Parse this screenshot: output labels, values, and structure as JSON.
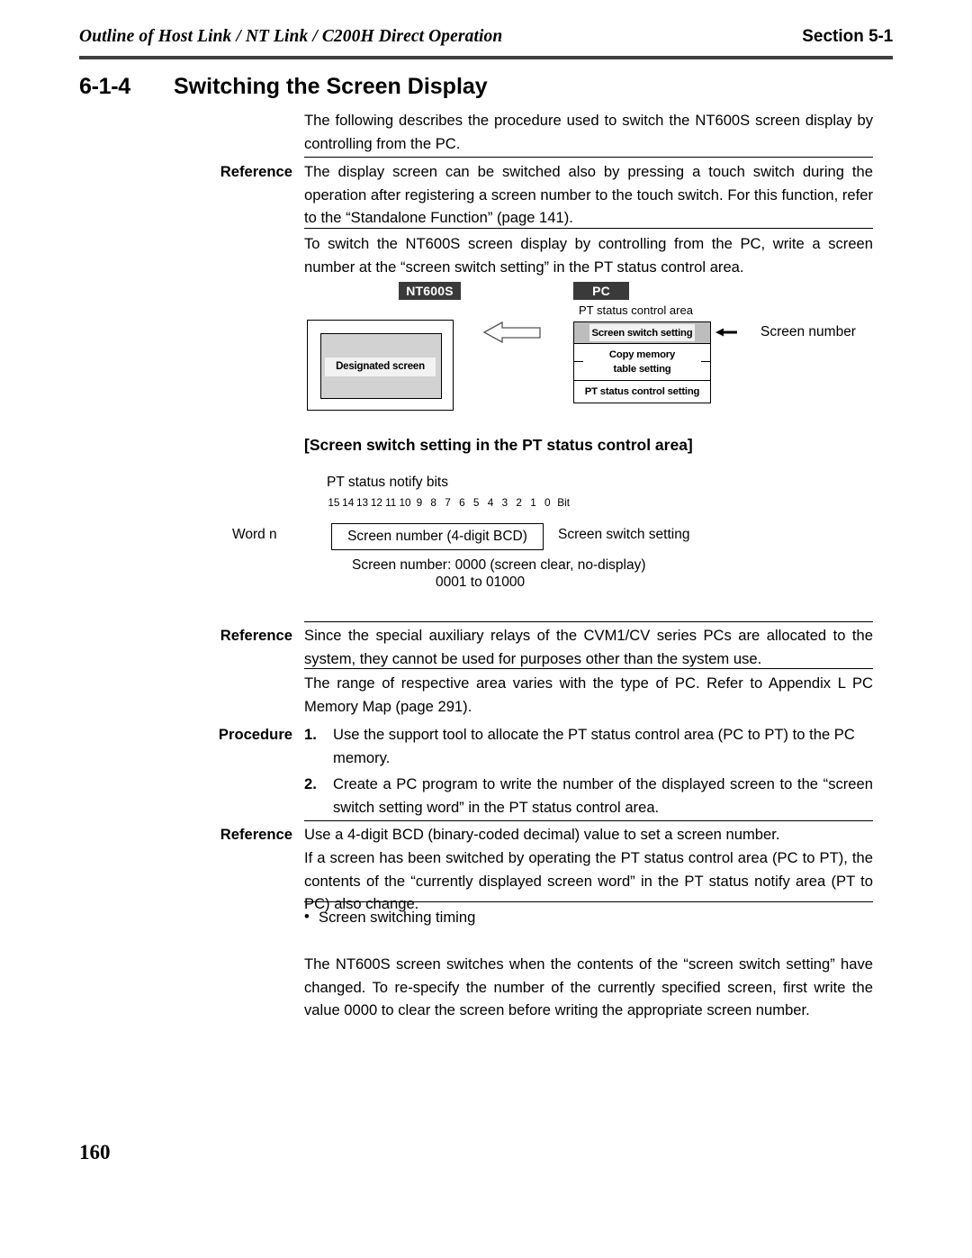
{
  "header": {
    "title": "Outline of Host Link / NT Link / C200H Direct Operation",
    "section_word": "Section",
    "section_number": "5-1"
  },
  "heading": {
    "number": "6-1-4",
    "title": "Switching the Screen Display"
  },
  "intro": {
    "text": "The following describes the procedure used to switch the NT600S screen display by controlling from the PC."
  },
  "reference1": {
    "label": "Reference",
    "text": "The display screen can be switched also by pressing a touch switch during the operation after registering a screen number to the touch switch. For this function, refer to the “Standalone Function” (page 141)."
  },
  "body1": {
    "text": "To switch the NT600S screen display by controlling from the PC, write a screen number at the “screen switch setting” in the PT status control area."
  },
  "diagram1": {
    "nt600s_tag": "NT600S",
    "pc_tag": "PC",
    "designated_screen": "Designated screen",
    "pt_status_control_area": "PT status control area",
    "rows": [
      "Screen switch setting",
      "Copy memory",
      "table setting",
      "PT status control setting"
    ],
    "screen_number_caption": "Screen number"
  },
  "diagram2": {
    "title": "[Screen switch setting in the PT status control area]",
    "notify_bits_label": "PT status notify bits",
    "bits": [
      "15",
      "14",
      "13",
      "12",
      "11",
      "10",
      "9",
      "8",
      "7",
      "6",
      "5",
      "4",
      "3",
      "2",
      "1",
      "0"
    ],
    "bit_word": "Bit",
    "word_label": "Word n",
    "box_label": "Screen number (4-digit BCD)",
    "right_label": "Screen switch setting",
    "note_line1": "Screen number: 0000 (screen clear, no-display)",
    "note_line2": "0001 to 01000"
  },
  "reference2": {
    "label": "Reference",
    "text": "Since the special auxiliary relays of the CVM1/CV series PCs are allocated to the system, they cannot be used for purposes other than the system use."
  },
  "body2": {
    "text": "The range of respective area varies with the type of PC. Refer to Appendix L PC Memory Map (page 291)."
  },
  "procedure": {
    "label": "Procedure",
    "items": [
      {
        "number": "1.",
        "text": "Use the support tool to allocate the PT status control area (PC to PT) to the PC memory."
      },
      {
        "number": "2.",
        "text": "Create a PC program to write the number of the displayed screen to the “screen switch setting word” in the PT status control area."
      }
    ]
  },
  "reference3": {
    "label": "Reference",
    "line1": "Use a 4-digit BCD (binary-coded decimal) value to set a screen number.",
    "line2": "If a screen has been switched by operating the PT status control area (PC to PT), the contents of the “currently displayed screen word” in the PT status notify area (PT to PC) also change."
  },
  "timing": {
    "bullet_char": "•",
    "bullet_text": "Screen switching timing",
    "text": "The NT600S screen switches when the contents of the “screen switch setting” have changed. To re-specify the number of the currently specified screen, first write the value 0000 to clear the screen before writing the appropriate screen number."
  },
  "footer": {
    "page_number": "160"
  },
  "colors": {
    "rule": "#3f3f3f",
    "tag_bg": "#3a3a3a",
    "screen_gray": "#d2d2d2",
    "band_gray": "#f2f2f2",
    "row_gray": "#bdbdbd"
  }
}
